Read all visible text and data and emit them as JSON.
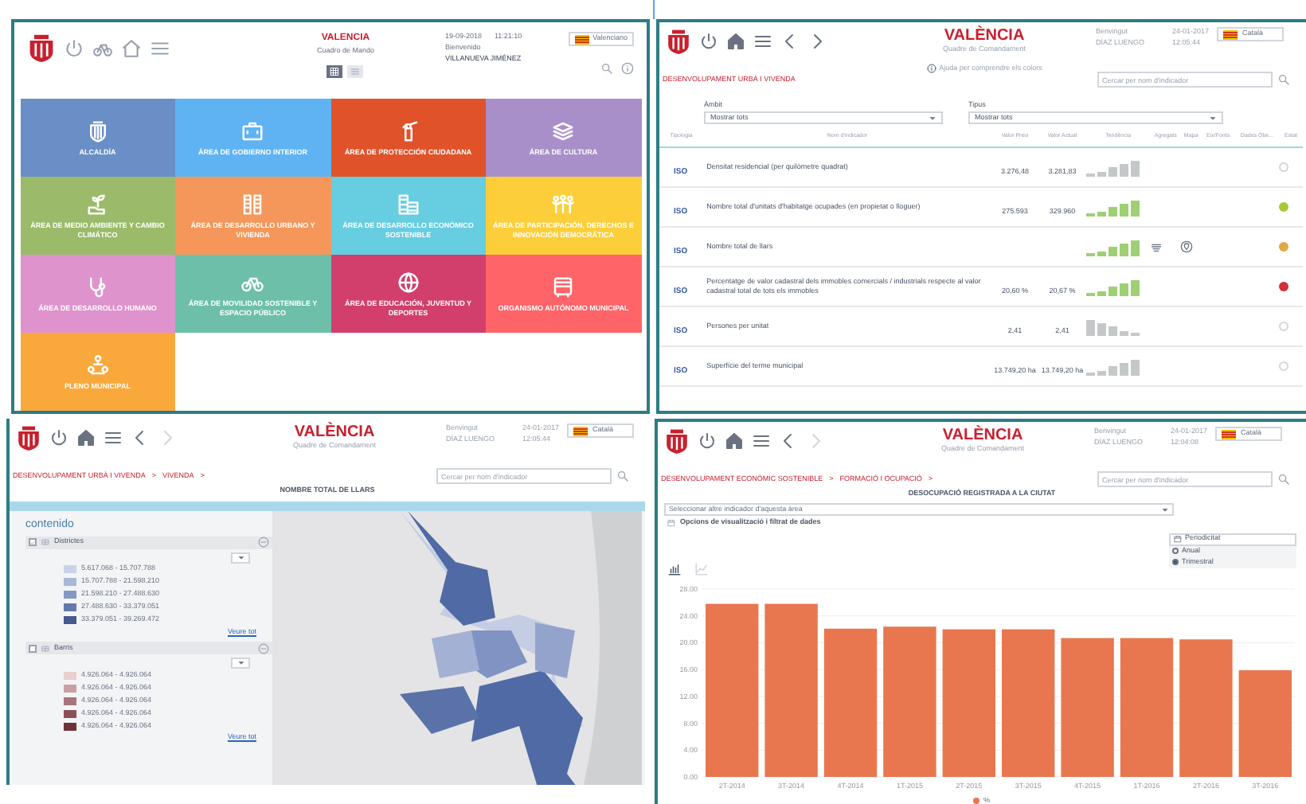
{
  "menu_panel": {
    "city": "VALENCIA",
    "subtitle": "Cuadro de Mando",
    "date": "19-09-2018",
    "time": "11:21:10",
    "greeting": "Bienvenido",
    "user": "VILLANUEVA JIMÉNEZ",
    "language": "Valenciano",
    "view_toggles": [
      {
        "kind": "grid",
        "selected": true
      },
      {
        "kind": "list",
        "selected": false
      }
    ],
    "tiles": [
      {
        "label": "ALCALDÍA",
        "color": "#6a8fc6"
      },
      {
        "label": "ÁREA DE GOBIERNO INTERIOR",
        "color": "#5fb3f3"
      },
      {
        "label": "ÁREA DE PROTECCIÓN CIUDADANA",
        "color": "#e0532a"
      },
      {
        "label": "ÁREA DE CULTURA",
        "color": "#a98fc9"
      },
      {
        "label": "ÁREA DE MEDIO AMBIENTE Y CAMBIO CLIMÁTICO",
        "color": "#9bbb6a"
      },
      {
        "label": "ÁREA DE DESARROLLO URBANO Y VIVIENDA",
        "color": "#f5975a"
      },
      {
        "label": "ÁREA DE DESARROLLO ECONÓMICO SOSTENIBLE",
        "color": "#67cde0"
      },
      {
        "label": "ÁREA DE PARTICIPACIÓN, DERECHOS E INNOVACIÓN DEMOCRÁTICA",
        "color": "#fccf3a"
      },
      {
        "label": "ÁREA DE DESARROLLO HUMANO",
        "color": "#df93cc"
      },
      {
        "label": "ÁREA DE MOVILIDAD SOSTENIBLE Y ESPACIO PÚBLICO",
        "color": "#6dbfaa"
      },
      {
        "label": "ÁREA DE EDUCACIÓN, JUVENTUD Y DEPORTES",
        "color": "#d23f6c"
      },
      {
        "label": "ORGANISMO AUTÓNOMO MUNICIPAL",
        "color": "#ff6468"
      },
      {
        "label": "PLENO MUNICIPAL",
        "color": "#f9a93b"
      }
    ]
  },
  "indicator_panel": {
    "city": "VALÈNCIA",
    "subtitle": "Quadre de Comandament",
    "greeting": "Benvingut",
    "user": "DÍAZ LUENGO",
    "date": "24-01-2017",
    "time": "12:05:44",
    "language": "Català",
    "help": "Ajuda per comprendre els colors",
    "search_placeholder": "Cercar per nom d'indicador",
    "breadcrumb": [
      {
        "label": "DESENVOLUPAMENT URBÀ I VIVENDA"
      }
    ],
    "filters": [
      {
        "label": "Àmbit",
        "value": "Mostrar tots"
      },
      {
        "label": "Tipus",
        "value": "Mostrar tots"
      }
    ],
    "columns": [
      "Tipologia",
      "Nom d'indicador",
      "Valor Previ",
      "Valor Actual",
      "Tendència",
      "Agregats",
      "Mapa",
      "Eix/Fonts",
      "Dades Obe...",
      "Estat"
    ],
    "rows": [
      {
        "type": "ISO",
        "name": "Densitat residencial (per quilòmetre quadrat)",
        "previous": "3.276,48",
        "current": "3.281,83",
        "kind": "rising",
        "trend_highlight": false,
        "has_aggregates": false,
        "has_map": false
      },
      {
        "type": "ISO",
        "name": "Nombre total d'unitats d'habitatge ocupades (en propietat o lloguer)",
        "previous": "275.593",
        "current": "329.960",
        "kind": "rising",
        "trend_highlight": true,
        "has_aggregates": false,
        "has_map": false,
        "color": "#a8c83a"
      },
      {
        "type": "ISO",
        "name": "Nombre total de llars",
        "kind": "rising",
        "trend_highlight": true,
        "has_aggregates": true,
        "has_map": true,
        "color": "#e0a848"
      },
      {
        "type": "ISO",
        "name": "Percentatge de valor cadastral dels immobles comercials / industrials respecte al valor cadastral total de tots els immobles",
        "previous": "20,60 %",
        "current": "20,67 %",
        "kind": "rising",
        "trend_highlight": true,
        "has_aggregates": false,
        "has_map": false,
        "color": "#d0303a"
      },
      {
        "type": "ISO",
        "name": "Persones per unitat",
        "previous": "2,41",
        "current": "2,41",
        "kind": "falling",
        "trend_highlight": false,
        "has_aggregates": false,
        "has_map": false
      },
      {
        "type": "ISO",
        "name": "Superfície del terme municipal",
        "previous": "13.749,20 ha",
        "current": "13.749,20 ha",
        "kind": "rising",
        "trend_highlight": false,
        "has_aggregates": false,
        "has_map": false
      }
    ]
  },
  "map_panel": {
    "city": "VALÈNCIA",
    "subtitle": "Quadre de Comandament",
    "greeting": "Benvingut",
    "user": "DÍAZ LUENGO",
    "date": "24-01-2017",
    "time": "12:05:44",
    "language": "Català",
    "search_placeholder": "Cercar per nom d'indicador",
    "breadcrumb": [
      {
        "label": "DESENVOLUPAMENT URBÀ I VIVENDA",
        "separator": ">"
      },
      {
        "label": "VIVENDA",
        "separator": ">"
      }
    ],
    "title": "NOMBRE TOTAL DE LLARS",
    "legend_title": "contenido",
    "layers": [
      {
        "name": "Districtes",
        "checked": true,
        "link": "Veure tot",
        "ranges": [
          {
            "label": "5.617.068 - 15.707.788",
            "color": "#c9d2e6"
          },
          {
            "label": "15.707.788 - 21.598.210",
            "color": "#a9b8d8"
          },
          {
            "label": "21.598.210 - 27.488.630",
            "color": "#8598c4"
          },
          {
            "label": "27.488.630 - 33.379.051",
            "color": "#6479ae"
          },
          {
            "label": "33.379.051 - 39.269.472",
            "color": "#45598f"
          }
        ]
      },
      {
        "name": "Barris",
        "checked": false,
        "link": "Veure tot",
        "ranges": [
          {
            "label": "4.926.064 - 4.926.064",
            "color": "#e8cfd0"
          },
          {
            "label": "4.926.064 - 4.926.064",
            "color": "#c9a0a3"
          },
          {
            "label": "4.926.064 - 4.926.064",
            "color": "#a8757a"
          },
          {
            "label": "4.926.064 - 4.926.064",
            "color": "#8c5158"
          },
          {
            "label": "4.926.064 - 4.926.064",
            "color": "#70323b"
          }
        ]
      }
    ]
  },
  "chart_panel": {
    "city": "VALÈNCIA",
    "subtitle": "Quadre de Comandament",
    "greeting": "Benvingut",
    "user": "DÍAZ LUENGO",
    "date": "24-01-2017",
    "time": "12:04:08",
    "language": "Català",
    "search_placeholder": "Cercar per nom d'indicador",
    "breadcrumb": [
      {
        "label": "DESENVOLUPAMENT ECONÒMIC SOSTENIBLE",
        "separator": ">"
      },
      {
        "label": "FORMACIÓ I OCUPACIÓ",
        "separator": ">"
      }
    ],
    "title": "DESOCUPACIÓ REGISTRADA A LA CIUTAT",
    "indicator_select": "Seleccionar altre indicador d'aquesta àrea",
    "options_label": "Opcions de visualització i filtrat de dades",
    "periodicity_label": "Periodicitat",
    "periods": [
      {
        "label": "Anual",
        "selected": false
      },
      {
        "label": "Trimestral",
        "selected": true
      }
    ],
    "chart_types": [
      {
        "kind": "bar",
        "selected": true
      },
      {
        "kind": "line",
        "selected": false
      }
    ],
    "chart_data": {
      "type": "bar",
      "grid": true,
      "categories": [
        "2T-2014",
        "3T-2014",
        "4T-2014",
        "1T-2015",
        "2T-2015",
        "3T-2015",
        "4T-2015",
        "1T-2016",
        "2T-2016",
        "3T-2016"
      ],
      "series": [
        {
          "name": "%",
          "color": "#e8774f",
          "values": [
            25.8,
            25.8,
            22.1,
            22.4,
            22.0,
            22.0,
            20.7,
            20.7,
            20.5,
            15.9
          ]
        }
      ],
      "ylim": [
        0,
        28
      ],
      "yticks": [
        {
          "value": 0,
          "label": "0.00"
        },
        {
          "value": 4,
          "label": "4.00"
        },
        {
          "value": 8,
          "label": "8.00"
        },
        {
          "value": 12,
          "label": "12.00"
        },
        {
          "value": 16,
          "label": "16.00"
        },
        {
          "value": 20,
          "label": "20.00"
        },
        {
          "value": 24,
          "label": "24.00"
        },
        {
          "value": 28,
          "label": "28.00"
        }
      ]
    }
  }
}
